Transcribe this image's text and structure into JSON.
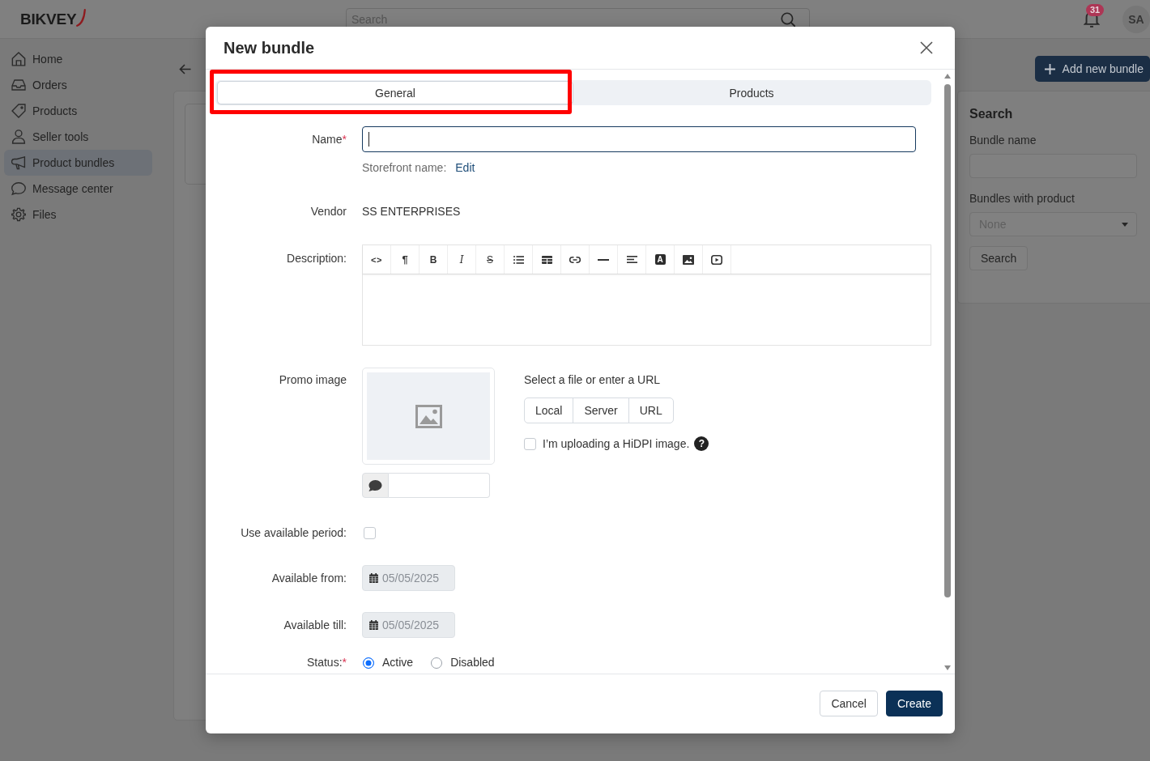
{
  "top_bar": {
    "logo": "BIKVEY",
    "search": {
      "placeholder": "Search"
    },
    "notifications": {
      "count": "31"
    },
    "avatar": "SA"
  },
  "sidebar": {
    "items": [
      {
        "label": "Home",
        "selected": false
      },
      {
        "label": "Orders",
        "selected": false
      },
      {
        "label": "Products",
        "selected": false
      },
      {
        "label": "Seller tools",
        "selected": false
      },
      {
        "label": "Product bundles",
        "selected": true
      },
      {
        "label": "Message center",
        "selected": false
      },
      {
        "label": "Files",
        "selected": false
      }
    ]
  },
  "page": {
    "add_button": "Add new bundle"
  },
  "search_panel": {
    "title": "Search",
    "fields": [
      {
        "kind": "text",
        "label": "Bundle name"
      },
      {
        "kind": "select",
        "label": "Bundles with product",
        "value": "None"
      }
    ],
    "button": "Search"
  },
  "dialog": {
    "title": "New bundle",
    "tabs": [
      {
        "label": "General",
        "selected": true
      },
      {
        "label": "Products",
        "selected": false
      }
    ],
    "name": {
      "label": "Name",
      "required_mark": "*",
      "focused": true
    },
    "storefront": {
      "label": "Storefront name:",
      "link": "Edit"
    },
    "vendor": {
      "label": "Vendor",
      "value": "SS ENTERPRISES"
    },
    "description": {
      "label": "Description:",
      "toolbar": [
        {
          "kind": "code",
          "label": "<>"
        },
        {
          "kind": "paragraph",
          "label": "¶"
        },
        {
          "kind": "bold",
          "label": "B"
        },
        {
          "kind": "italic",
          "label": "I"
        },
        {
          "kind": "strike",
          "label": "S"
        },
        {
          "kind": "list"
        },
        {
          "kind": "table"
        },
        {
          "kind": "link"
        },
        {
          "kind": "rule"
        },
        {
          "kind": "align"
        },
        {
          "kind": "color",
          "label": "A"
        },
        {
          "kind": "image"
        },
        {
          "kind": "video"
        }
      ]
    },
    "promo_image": {
      "label": "Promo image",
      "prompt": "Select a file or enter a URL",
      "sources": [
        "Local",
        "Server",
        "URL"
      ],
      "hidpi": {
        "label": "I’m uploading a HiDPI image.",
        "checked": false
      },
      "help": "?"
    },
    "available_period": {
      "label": "Use available period:",
      "checked": false
    },
    "dates": [
      {
        "label": "Available from:",
        "value": "05/05/2025",
        "disabled": true
      },
      {
        "label": "Available till:",
        "value": "05/05/2025",
        "disabled": true
      }
    ],
    "status": {
      "label": "Status:",
      "required_mark": "*",
      "options": [
        {
          "label": "Active",
          "selected": true
        },
        {
          "label": "Disabled",
          "selected": false
        }
      ]
    },
    "buttons": [
      {
        "label": "Cancel",
        "kind": "secondary"
      },
      {
        "label": "Create",
        "kind": "primary"
      }
    ]
  }
}
